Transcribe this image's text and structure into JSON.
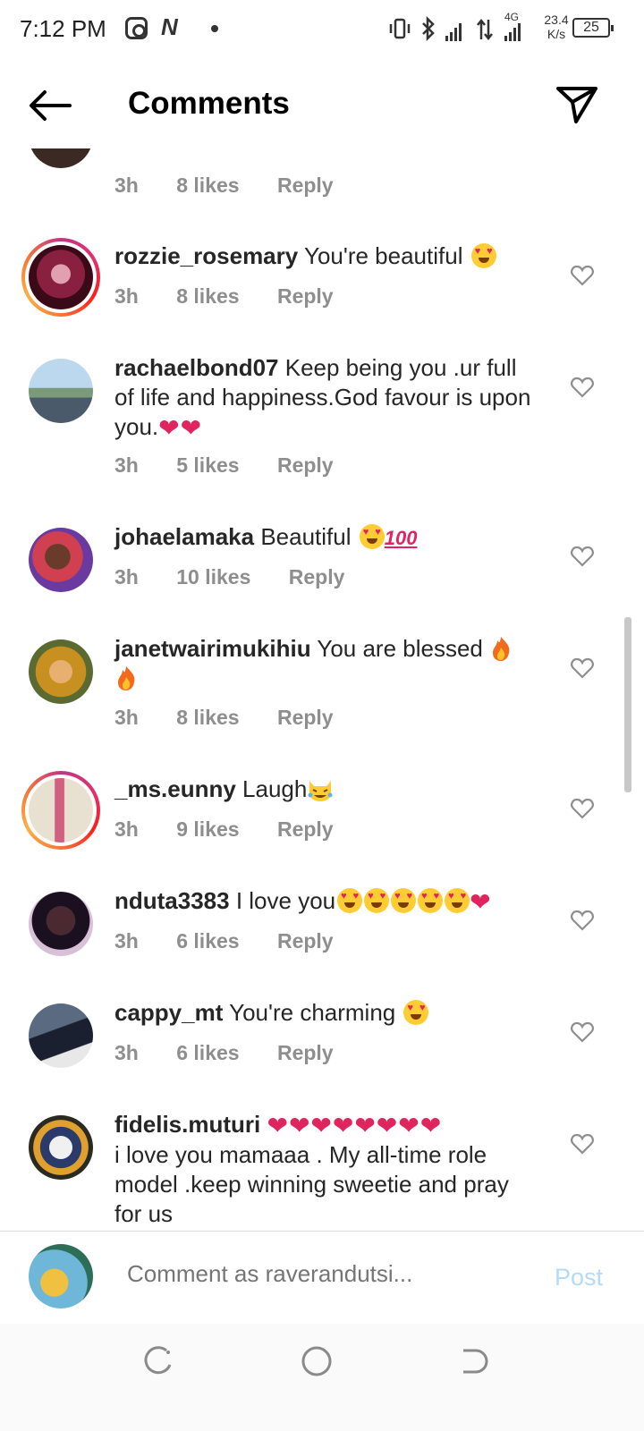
{
  "status_bar": {
    "time": "7:12 PM",
    "network": "4G",
    "speed_value": "23.4",
    "speed_unit": "K/s",
    "battery": "25"
  },
  "header": {
    "title": "Comments"
  },
  "meta_labels": {
    "reply": "Reply"
  },
  "comments": [
    {
      "username": "",
      "text": "",
      "time": "3h",
      "likes": "8 likes",
      "reply": "Reply"
    },
    {
      "username": "rozzie_rosemary",
      "text": " You're beautiful ",
      "time": "3h",
      "likes": "8 likes",
      "reply": "Reply"
    },
    {
      "username": "rachaelbond07",
      "text": " Keep being you .ur full of life and happiness.God favour is upon you.",
      "time": "3h",
      "likes": "5 likes",
      "reply": "Reply"
    },
    {
      "username": "johaelamaka",
      "text": " Beautiful ",
      "time": "3h",
      "likes": "10 likes",
      "reply": "Reply"
    },
    {
      "username": "janetwairimukihiu",
      "text": " You are blessed ",
      "time": "3h",
      "likes": "8 likes",
      "reply": "Reply"
    },
    {
      "username": "_ms.eunny",
      "text": " Laugh",
      "time": "3h",
      "likes": "9 likes",
      "reply": "Reply"
    },
    {
      "username": "nduta3383",
      "text": " I love you",
      "time": "3h",
      "likes": "6 likes",
      "reply": "Reply"
    },
    {
      "username": "cappy_mt",
      "text": " You're charming ",
      "time": "3h",
      "likes": "6 likes",
      "reply": "Reply"
    },
    {
      "username": "fidelis.muturi",
      "text": "i love you mamaaa . My all-time role model .keep winning sweetie and pray for us",
      "time": "",
      "likes": "",
      "reply": ""
    }
  ],
  "composer": {
    "placeholder": "Comment as raverandutsi...",
    "post_label": "Post"
  },
  "colors": {
    "like_grey": "#8e8e8e",
    "post_blue": "#b3dbf8",
    "heart_red": "#e0245e"
  },
  "icons": [
    "back-arrow-icon",
    "direct-send-icon",
    "heart-outline-icon",
    "instagram-icon",
    "battery-icon",
    "recents-icon",
    "home-icon",
    "back-nav-icon"
  ]
}
